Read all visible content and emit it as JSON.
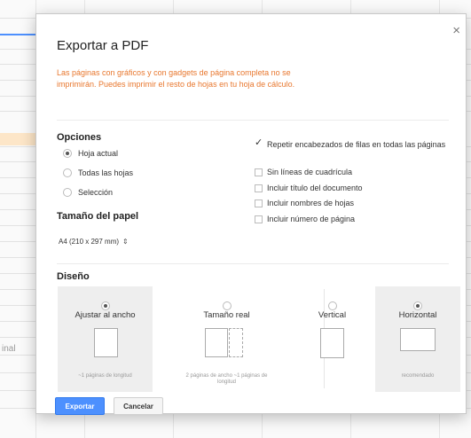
{
  "background": {
    "side_label": "inal"
  },
  "dialog": {
    "title": "Exportar a PDF",
    "close_glyph": "×",
    "warning": "Las páginas con gráficos y con gadgets de página completa no se imprimirán. Puedes imprimir el resto de hojas en tu hoja de cálculo.",
    "warning_color": "#e8772e"
  },
  "options": {
    "title": "Opciones",
    "scope": [
      {
        "label": "Hoja actual",
        "selected": true
      },
      {
        "label": "Todas las hojas",
        "selected": false
      },
      {
        "label": "Selección",
        "selected": false
      }
    ],
    "checks": [
      {
        "label": "Repetir encabezados de filas en todas las páginas",
        "checked": true
      },
      {
        "label": "Sin líneas de cuadrícula",
        "checked": false
      },
      {
        "label": "Incluir título del documento",
        "checked": false
      },
      {
        "label": "Incluir nombres de hojas",
        "checked": false
      },
      {
        "label": "Incluir número de página",
        "checked": false
      }
    ]
  },
  "paper": {
    "title": "Tamaño del papel",
    "selected": "A4 (210 x 297 mm)"
  },
  "design": {
    "title": "Diseño",
    "fit": [
      {
        "label": "Ajustar al ancho",
        "sub": "~1 páginas de longitud",
        "selected": true
      },
      {
        "label": "Tamaño real",
        "sub": "2 páginas de ancho ~1 páginas de longitud",
        "selected": false
      }
    ],
    "orientation": [
      {
        "label": "Vertical",
        "sub": "",
        "selected": false
      },
      {
        "label": "Horizontal",
        "sub": "recomendado",
        "selected": true
      }
    ]
  },
  "buttons": {
    "export": "Exportar",
    "cancel": "Cancelar",
    "accent": "#4d90fe"
  }
}
